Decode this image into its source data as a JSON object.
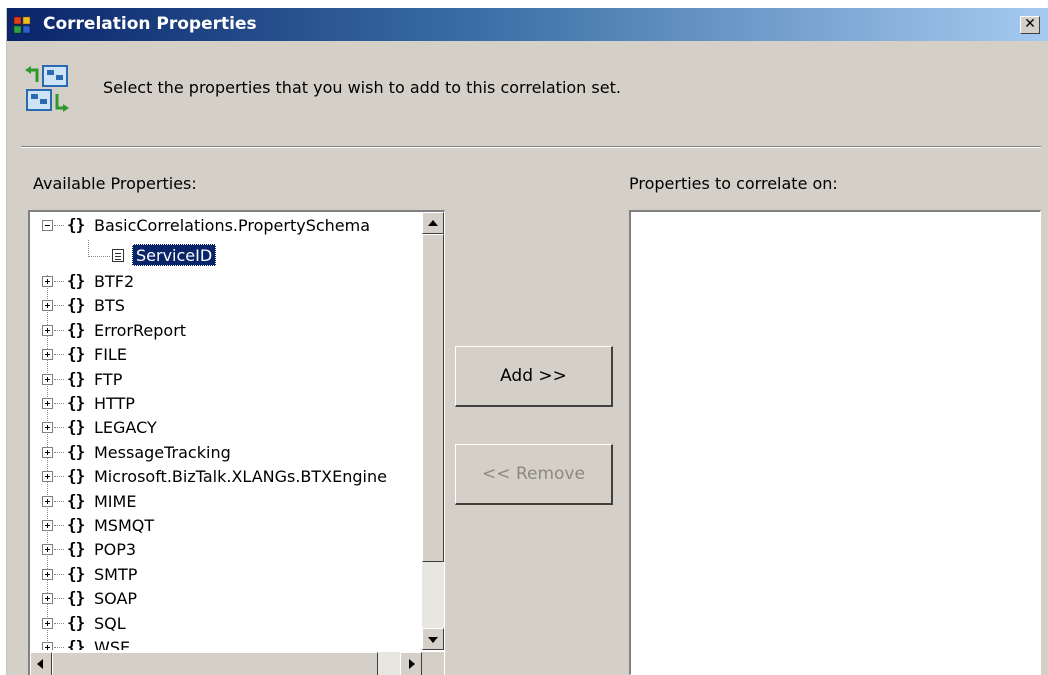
{
  "window": {
    "title": "Correlation Properties",
    "close_glyph": "✕"
  },
  "header": {
    "instruction": "Select the properties that you wish to add to this correlation set."
  },
  "available": {
    "label": "Available Properties:",
    "namespace_glyph": "{}",
    "expanded_node": "BasicCorrelations.PropertySchema",
    "selected_child": "ServiceID",
    "nodes": [
      "BTF2",
      "BTS",
      "ErrorReport",
      "FILE",
      "FTP",
      "HTTP",
      "LEGACY",
      "MessageTracking",
      "Microsoft.BizTalk.XLANGs.BTXEngine",
      "MIME",
      "MSMQT",
      "POP3",
      "SMTP",
      "SOAP",
      "SQL",
      "WSE"
    ]
  },
  "buttons": {
    "add_label": "Add >>",
    "remove_label": "<< Remove"
  },
  "target": {
    "label": "Properties to correlate on:"
  },
  "colors": {
    "dialog_bg": "#d4d0c8",
    "title_start": "#0a246a",
    "title_end": "#a6caf0",
    "selection": "#0a246a"
  }
}
